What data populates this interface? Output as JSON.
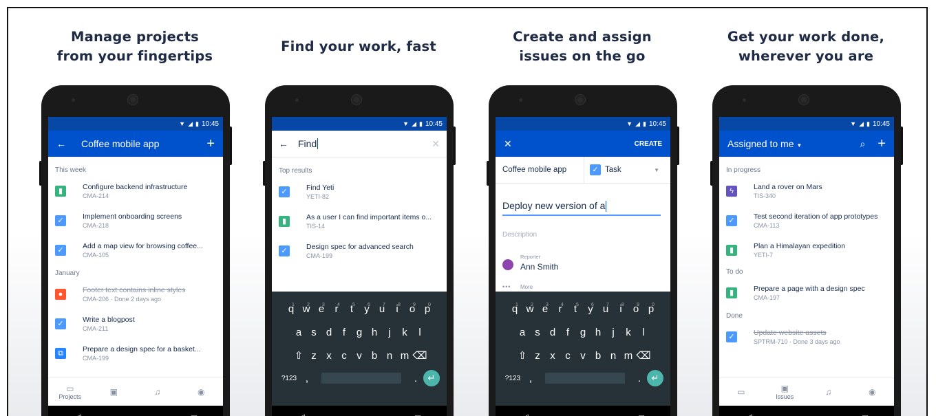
{
  "status_time": "10:45",
  "panels": [
    {
      "caption": "Manage projects\nfrom your fingertips",
      "appbar_title": "Coffee mobile app",
      "sections": [
        {
          "label": "This week",
          "items": [
            {
              "title": "Configure backend infrastructure",
              "key": "CMA-214",
              "icon": "story",
              "done": false
            },
            {
              "title": "Implement onboarding screens",
              "key": "CMA-218",
              "icon": "task",
              "done": false
            },
            {
              "title": "Add a map view for browsing coffee...",
              "key": "CMA-105",
              "icon": "task",
              "done": false
            }
          ]
        },
        {
          "label": "January",
          "items": [
            {
              "title": "Footer text contains inline styles",
              "key": "CMA-206 · Done 2 days ago",
              "icon": "bug",
              "done": true
            },
            {
              "title": "Write a blogpost",
              "key": "CMA-211",
              "icon": "task",
              "done": false
            },
            {
              "title": "Prepare a design spec for a basket...",
              "key": "CMA-199",
              "icon": "subtask",
              "done": false
            }
          ]
        }
      ],
      "bottom_nav_label": "Projects"
    },
    {
      "caption": "Find your work, fast",
      "search_value": "Find",
      "section": "Top results",
      "items": [
        {
          "title": "Find Yeti",
          "key": "YETI-82",
          "icon": "task"
        },
        {
          "title": "As a user I can find important items o...",
          "key": "TIS-14",
          "icon": "story"
        },
        {
          "title": "Design spec for advanced search",
          "key": "CMA-199",
          "icon": "task"
        }
      ],
      "keyboard": {
        "row1": [
          "q",
          "w",
          "e",
          "r",
          "t",
          "y",
          "u",
          "i",
          "o",
          "p"
        ],
        "row1_nums": [
          "1",
          "2",
          "3",
          "4",
          "5",
          "6",
          "7",
          "8",
          "9",
          "0"
        ],
        "row2": [
          "a",
          "s",
          "d",
          "f",
          "g",
          "h",
          "j",
          "k",
          "l"
        ],
        "row3": [
          "z",
          "x",
          "c",
          "v",
          "b",
          "n",
          "m"
        ],
        "symbols": "?123",
        "comma": ",",
        "period": "."
      }
    },
    {
      "caption": "Create and assign\nissues on the go",
      "create_label": "CREATE",
      "project": "Coffee mobile app",
      "issue_type": "Task",
      "summary_value": "Deploy new version of a",
      "description_placeholder": "Description",
      "reporter_label": "Reporter",
      "reporter_name": "Ann Smith",
      "more_label": "More"
    },
    {
      "caption": "Get your work done,\nwherever you are",
      "appbar_title": "Assigned to me",
      "sections": [
        {
          "label": "In progress",
          "items": [
            {
              "title": "Land a rover on Mars",
              "key": "TIS-340",
              "icon": "epic",
              "done": false
            },
            {
              "title": "Test second iteration of app prototypes",
              "key": "CMA-113",
              "icon": "task",
              "done": false
            },
            {
              "title": "Plan a Himalayan expedition",
              "key": "YETI-7",
              "icon": "story",
              "done": false
            }
          ]
        },
        {
          "label": "To do",
          "items": [
            {
              "title": "Prepare a page with a design spec",
              "key": "CMA-197",
              "icon": "story",
              "done": false
            }
          ]
        },
        {
          "label": "Done",
          "items": [
            {
              "title": "Update website assets",
              "key": "SPTRM-710 · Done 3 days ago",
              "icon": "task",
              "done": true
            }
          ]
        }
      ],
      "bottom_nav_label": "Issues"
    }
  ]
}
